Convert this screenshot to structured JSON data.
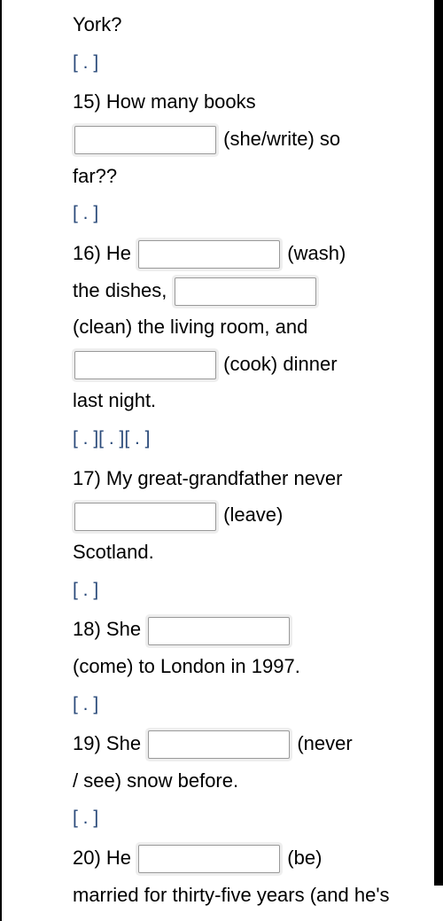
{
  "frag_top": "York?",
  "hint_label": "[ . ]",
  "hint_triple": "[ . ][ . ][ . ]",
  "q15": {
    "num": "15) How many books",
    "hint": "(she/write) so",
    "tail": "far??"
  },
  "q16": {
    "num": "16) He",
    "hint1": "(wash)",
    "line2a": "the dishes,",
    "line3": "(clean) the living room, and",
    "hint3": "(cook) dinner",
    "tail": "last night."
  },
  "q17": {
    "num": "17) My great-grandfather never",
    "hint": "(leave)",
    "tail": "Scotland."
  },
  "q18": {
    "num": "18) She",
    "line2": "(come) to London in 1997."
  },
  "q19": {
    "num": "19) She",
    "hint": "(never",
    "line2": "/ see) snow before."
  },
  "q20": {
    "num": "20) He",
    "hint": "(be)",
    "line2": "married for thirty-five years (and he's"
  }
}
